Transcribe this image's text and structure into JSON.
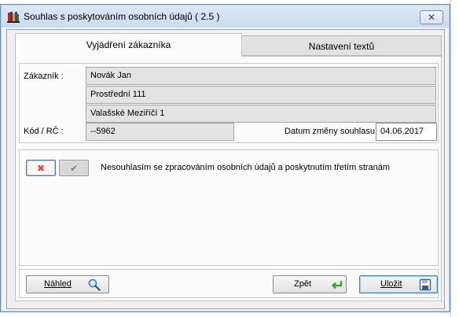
{
  "window": {
    "title": "Souhlas s poskytováním osobních údajů ( 2.5 )",
    "close_glyph": "✕",
    "app_icon": "books-icon"
  },
  "tabs": [
    {
      "label": "Vyjádření zákazníka",
      "active": true
    },
    {
      "label": "Nastavení textů",
      "active": false
    }
  ],
  "customer": {
    "customer_label": "Zákazník :",
    "name": "Novák Jan",
    "street": "Prostřední 111",
    "city": "Valašské Meziříčí 1",
    "code_label": "Kód / RČ :",
    "code": "--5962",
    "date_label": "Datum změny souhlasu",
    "date": "04.06.2017"
  },
  "consent": {
    "no_icon": "cross-icon",
    "no_glyph": "✖",
    "yes_icon": "check-icon",
    "yes_glyph": "✔",
    "selected": "no",
    "text": "Nesouhlasím se zpracováním osobních údajů a poskytnutím třetím stranám"
  },
  "footer": {
    "preview_label": "Náhled",
    "preview_icon": "magnifier-icon",
    "back_label": "Zpět",
    "back_icon": "return-arrow-icon",
    "save_label": "Uložit",
    "save_icon": "floppy-disk-icon"
  },
  "colors": {
    "titlebar": "#c8dbef",
    "focus_border": "#3f84d6",
    "cross": "#e04a36",
    "back_arrow": "#3aa832"
  }
}
